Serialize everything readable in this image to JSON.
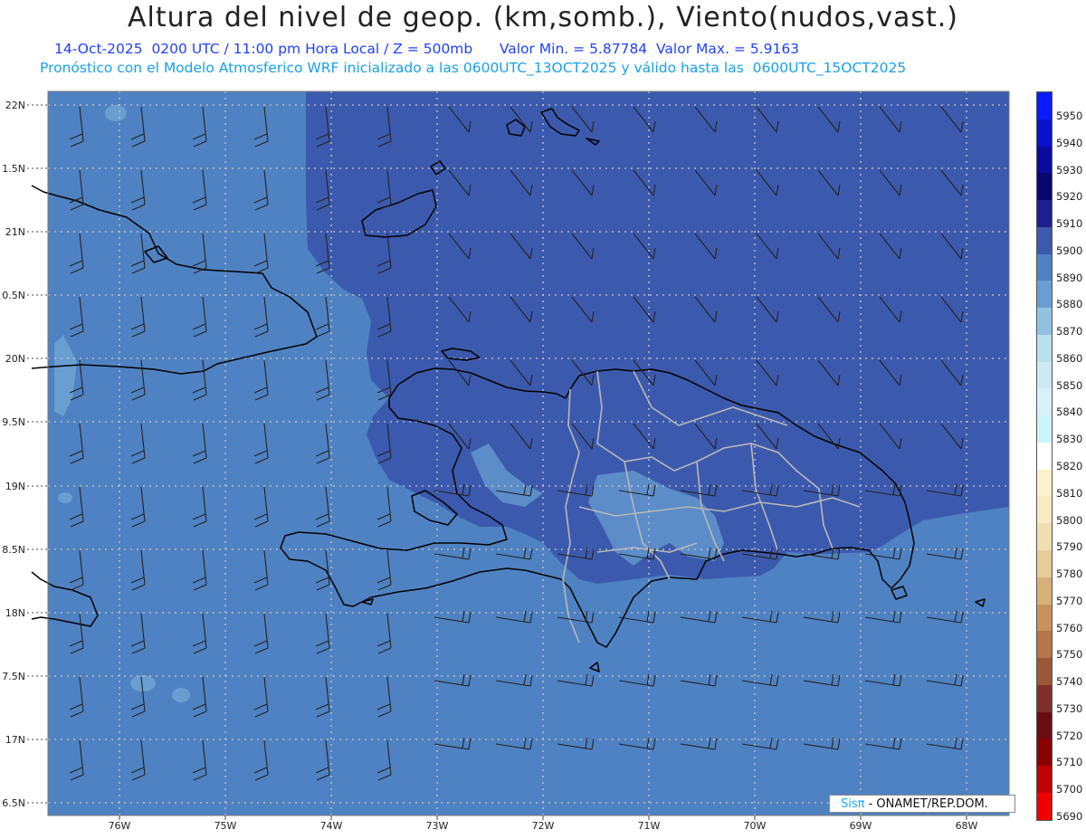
{
  "header": {
    "title": "Altura del nivel de geop. (km,somb.), Viento(nudos,vast.)",
    "subtitle_left": "14-Oct-2025  0200 UTC / 11:00 pm Hora Local / Z = 500mb",
    "subtitle_min": "Valor Min. = 5.87784",
    "subtitle_max": "Valor Max. = 5.9163",
    "subtitle2": "Pronóstico con el Modelo Atmosferico WRF inicializado a las 0600UTC_13OCT2025 y válido hasta las  0600UTC_15OCT2025"
  },
  "map": {
    "lat_labels": [
      "22N",
      "1.5N",
      "21N",
      "0.5N",
      "20N",
      "9.5N",
      "19N",
      "8.5N",
      "18N",
      "7.5N",
      "17N",
      "6.5N"
    ],
    "lon_labels": [
      "76W",
      "75W",
      "74W",
      "73W",
      "72W",
      "71W",
      "70W",
      "69W",
      "68W"
    ],
    "colors": {
      "field_5890": "#4f82c2",
      "field_5900": "#3c5aad",
      "field_5880": "#6a9ed1",
      "coast": "#000000",
      "borders": "#b8b8b8",
      "grid": "#c8c8c8"
    }
  },
  "colorbar": {
    "labels": [
      "5950",
      "5940",
      "5930",
      "5920",
      "5910",
      "5900",
      "5890",
      "5880",
      "5870",
      "5860",
      "5850",
      "5840",
      "5830",
      "5820",
      "5810",
      "5800",
      "5790",
      "5780",
      "5770",
      "5760",
      "5750",
      "5740",
      "5730",
      "5720",
      "5710",
      "5700",
      "5690"
    ],
    "colors": [
      "#0a1cff",
      "#0b12cc",
      "#0a0a9e",
      "#080870",
      "#1e1e8c",
      "#3c5aad",
      "#4f82c2",
      "#6a9ed1",
      "#92c2e2",
      "#b9e0ef",
      "#cdeaf4",
      "#d9f1f8",
      "#ccf4fb",
      "#ffffff",
      "#fbf1cc",
      "#f7ebc2",
      "#f1deb0",
      "#e7cc96",
      "#d8b07a",
      "#c89260",
      "#b47648",
      "#9b5838",
      "#7e3028",
      "#6a0c14",
      "#8a0000",
      "#c00000",
      "#ee0000"
    ]
  },
  "footer": {
    "credit_sis": "Sisπ",
    "credit_rest": " - ONAMET/REP.DOM."
  }
}
